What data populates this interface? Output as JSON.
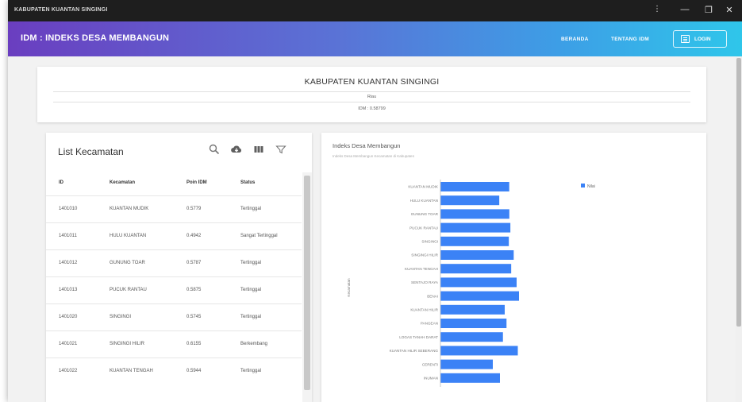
{
  "window": {
    "title": "KABUPATEN KUANTAN SINGINGI",
    "controls": {
      "menu": "⋮",
      "minimize": "—",
      "maximize": "❐",
      "close": "✕"
    }
  },
  "appbar": {
    "title": "IDM : INDEKS DESA MEMBANGUN",
    "nav": [
      "BERANDA",
      "TENTANG IDM"
    ],
    "login_label": "LOGIN",
    "login_icon": "login-list-icon"
  },
  "header": {
    "title": "KABUPATEN KUANTAN SINGINGI",
    "province": "Riau",
    "idm": "IDM : 0.58799"
  },
  "list": {
    "title": "List Kecamatan",
    "tools": [
      "search-icon",
      "cloud-download-icon",
      "view-column-icon",
      "filter-icon"
    ],
    "columns": [
      "ID",
      "Kecamatan",
      "Poin IDM",
      "Status"
    ],
    "rows": [
      [
        "1401010",
        "KUANTAN MUDIK",
        "0.5779",
        "Tertinggal"
      ],
      [
        "1401011",
        "HULU KUANTAN",
        "0.4942",
        "Sangat Tertinggal"
      ],
      [
        "1401012",
        "GUNUNG TOAR",
        "0.5787",
        "Tertinggal"
      ],
      [
        "1401013",
        "PUCUK RANTAU",
        "0.5875",
        "Tertinggal"
      ],
      [
        "1401020",
        "SINGINGI",
        "0.5745",
        "Tertinggal"
      ],
      [
        "1401021",
        "SINGINGI HILIR",
        "0.6155",
        "Berkembang"
      ],
      [
        "1401022",
        "KUANTAN TENGAH",
        "0.5944",
        "Tertinggal"
      ]
    ]
  },
  "chart": {
    "title": "Indeks Desa Membangun",
    "subtitle": "Indeks Desa Membangun Kecamatan di Kabupaten",
    "accent": "#3b82f6"
  },
  "chart_data": {
    "type": "bar",
    "orientation": "horizontal",
    "title": "Indeks Desa Membangun",
    "ylabel": "Kecamatan",
    "legend": {
      "position": "top-right",
      "entries": [
        "Nilai"
      ]
    },
    "categories": [
      "KUANTAN MUDIK",
      "HULU KUANTAN",
      "GUNUNG TOAR",
      "PUCUK RANTAU",
      "SINGINGI",
      "SINGINGI HILIR",
      "KUANTAN TENGAH",
      "SENTAJO RAYA",
      "BENAI",
      "KUANTAN HILIR",
      "PANGEAN",
      "LOGAS TANAH DARAT",
      "KUANTAN HILIR SEBERANG",
      "CERENTI",
      "INUMAN"
    ],
    "series": [
      {
        "name": "Nilai",
        "values": [
          0.5779,
          0.4942,
          0.5787,
          0.5875,
          0.5745,
          0.6155,
          0.5944,
          0.64,
          0.66,
          0.54,
          0.555,
          0.525,
          0.65,
          0.44,
          0.5
        ]
      }
    ],
    "xlim": [
      0,
      1
    ]
  }
}
